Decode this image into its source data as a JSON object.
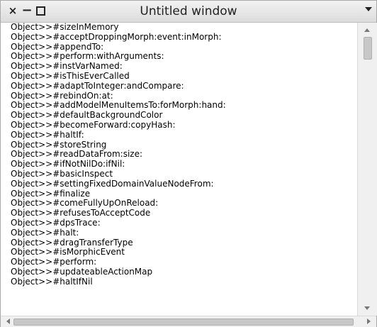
{
  "window": {
    "title": "Untitled window",
    "close_glyph": "×",
    "minimize_glyph": "−",
    "icons": {
      "close": "close-icon",
      "minimize": "minimize-icon",
      "maximize": "maximize-icon",
      "menu": "chevron-down-icon"
    }
  },
  "list": {
    "items": [
      "Object>>#sizeInMemory",
      "Object>>#acceptDroppingMorph:event:inMorph:",
      "Object>>#appendTo:",
      "Object>>#perform:withArguments:",
      "Object>>#instVarNamed:",
      "Object>>#isThisEverCalled",
      "Object>>#adaptToInteger:andCompare:",
      "Object>>#rebindOn:at:",
      "Object>>#addModelMenuItemsTo:forMorph:hand:",
      "Object>>#defaultBackgroundColor",
      "Object>>#becomeForward:copyHash:",
      "Object>>#haltIf:",
      "Object>>#storeString",
      "Object>>#readDataFrom:size:",
      "Object>>#ifNotNilDo:ifNil:",
      "Object>>#basicInspect",
      "Object>>#settingFixedDomainValueNodeFrom:",
      "Object>>#finalize",
      "Object>>#comeFullyUpOnReload:",
      "Object>>#refusesToAcceptCode",
      "Object>>#dpsTrace:",
      "Object>>#halt:",
      "Object>>#dragTransferType",
      "Object>>#isMorphicEvent",
      "Object>>#perform:",
      "Object>>#updateableActionMap",
      "Object>>#haltIfNil"
    ]
  },
  "scrollbars": {
    "icons": {
      "up": "arrow-up-icon",
      "down": "arrow-down-icon",
      "left": "arrow-left-icon",
      "right": "arrow-right-icon"
    }
  }
}
